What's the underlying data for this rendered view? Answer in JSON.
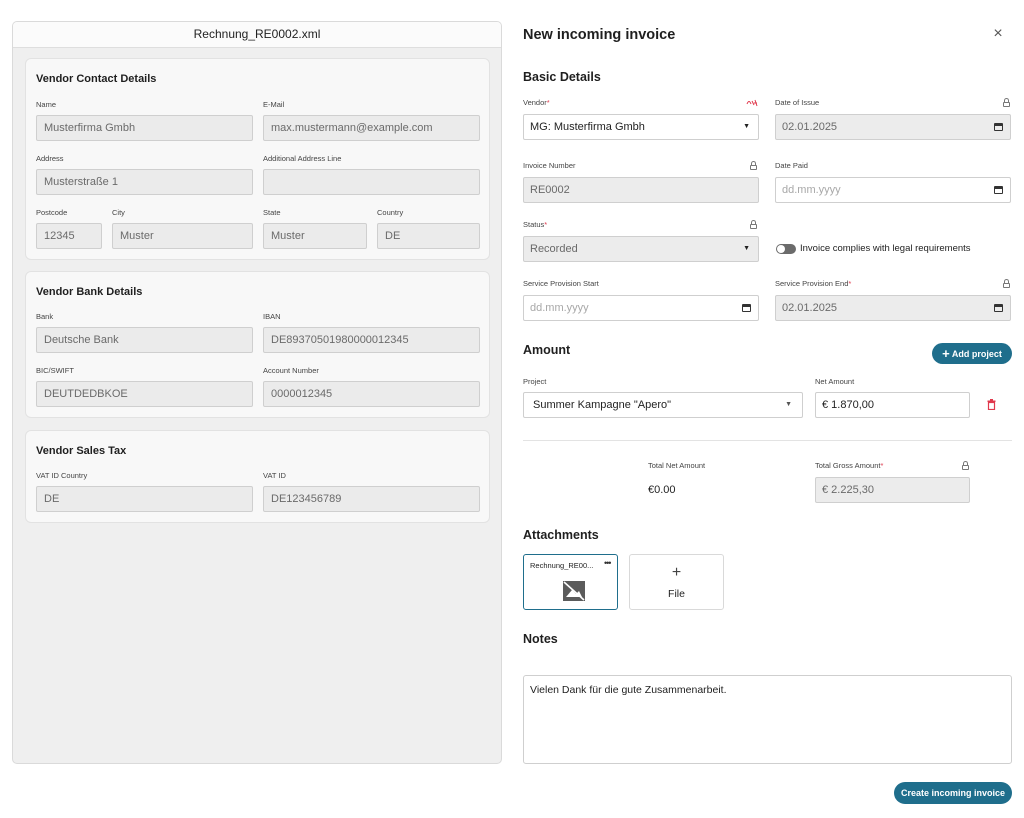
{
  "left": {
    "filename": "Rechnung_RE0002.xml",
    "contact": {
      "title": "Vendor Contact Details",
      "name_label": "Name",
      "name": "Musterfirma Gmbh",
      "email_label": "E-Mail",
      "email": "max.mustermann@example.com",
      "address_label": "Address",
      "address": "Musterstraße 1",
      "address2_label": "Additional Address Line",
      "address2": "",
      "postcode_label": "Postcode",
      "postcode": "12345",
      "city_label": "City",
      "city": "Muster",
      "state_label": "State",
      "state": "Muster",
      "country_label": "Country",
      "country": "DE"
    },
    "bank": {
      "title": "Vendor Bank Details",
      "bank_label": "Bank",
      "bank": "Deutsche Bank",
      "iban_label": "IBAN",
      "iban": "DE89370501980000012345",
      "bic_label": "BIC/SWIFT",
      "bic": "DEUTDEDBKOE",
      "account_label": "Account Number",
      "account": "0000012345"
    },
    "tax": {
      "title": "Vendor Sales Tax",
      "vat_country_label": "VAT ID Country",
      "vat_country": "DE",
      "vat_id_label": "VAT ID",
      "vat_id": "DE123456789"
    }
  },
  "right": {
    "title": "New incoming invoice",
    "basic": {
      "title": "Basic Details",
      "vendor_label": "Vendor",
      "vendor": "MG: Musterfirma Gmbh",
      "date_issue_label": "Date of Issue",
      "date_issue": "02.01.2025",
      "invoice_number_label": "Invoice Number",
      "invoice_number": "RE0002",
      "date_paid_label": "Date Paid",
      "date_paid_placeholder": "dd.mm.yyyy",
      "status_label": "Status",
      "status": "Recorded",
      "complies_label": "Invoice complies with legal requirements",
      "service_start_label": "Service Provision Start",
      "service_start_placeholder": "dd.mm.yyyy",
      "service_end_label": "Service Provision End",
      "service_end": "02.01.2025",
      "required_mark": "*"
    },
    "amount": {
      "title": "Amount",
      "add_project": "Add project",
      "project_label": "Project",
      "project": "Summer Kampagne \"Apero\"",
      "net_label": "Net Amount",
      "net": "€ 1.870,00",
      "total_net_label": "Total Net Amount",
      "total_net": "€0.00",
      "total_gross_label": "Total Gross Amount",
      "total_gross": "€ 2.225,30"
    },
    "attachments": {
      "title": "Attachments",
      "file_name": "Rechnung_RE00...",
      "add_file": "File"
    },
    "notes": {
      "title": "Notes",
      "text": "Vielen Dank für die gute Zusammenarbeit."
    },
    "submit": "Create incoming invoice"
  },
  "colors": {
    "accent": "#1f6e8c",
    "danger": "#e0394d"
  }
}
